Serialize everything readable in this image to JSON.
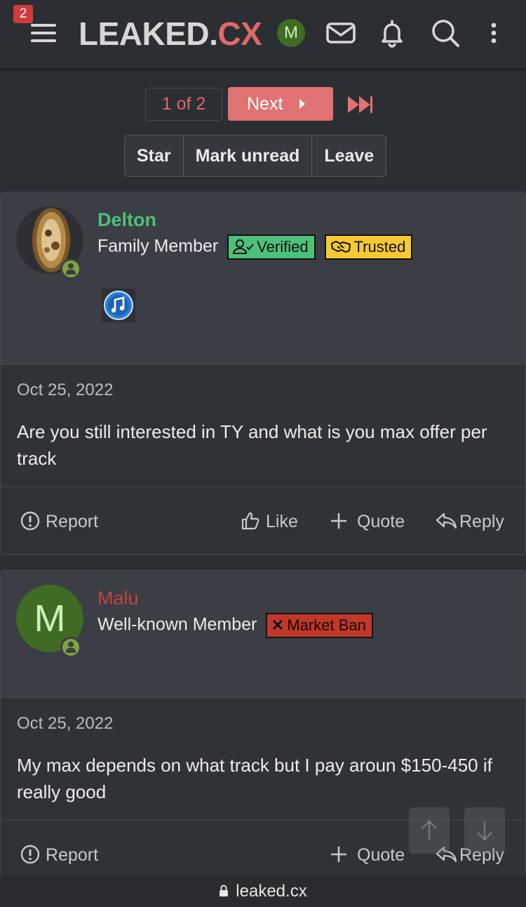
{
  "header": {
    "notification_count": "2",
    "logo_part1": "LEAKED.",
    "logo_part2": "CX",
    "avatar_letter": "M"
  },
  "pagination": {
    "current": "1 of 2",
    "next_label": "Next"
  },
  "thread_actions": [
    "Star",
    "Mark unread",
    "Leave"
  ],
  "posts": [
    {
      "username": "Delton",
      "username_color": "#4cc17a",
      "user_title": "Family Member",
      "badges": [
        "Verified",
        "Trusted"
      ],
      "date": "Oct 25, 2022",
      "body": "Are you still interested in TY and what is you max offer per track",
      "footer": {
        "report": "Report",
        "like": "Like",
        "quote": "Quote",
        "reply": "Reply"
      }
    },
    {
      "username": "Malu",
      "username_color": "#c0453c",
      "avatar_letter": "M",
      "user_title": "Well-known Member",
      "badges": [
        "Market Ban"
      ],
      "date": "Oct 25, 2022",
      "body": "My max depends on what track but I pay aroun $150-450 if really good",
      "footer": {
        "report": "Report",
        "quote": "Quote",
        "reply": "Reply"
      }
    }
  ],
  "browser": {
    "url": "leaked.cx"
  }
}
